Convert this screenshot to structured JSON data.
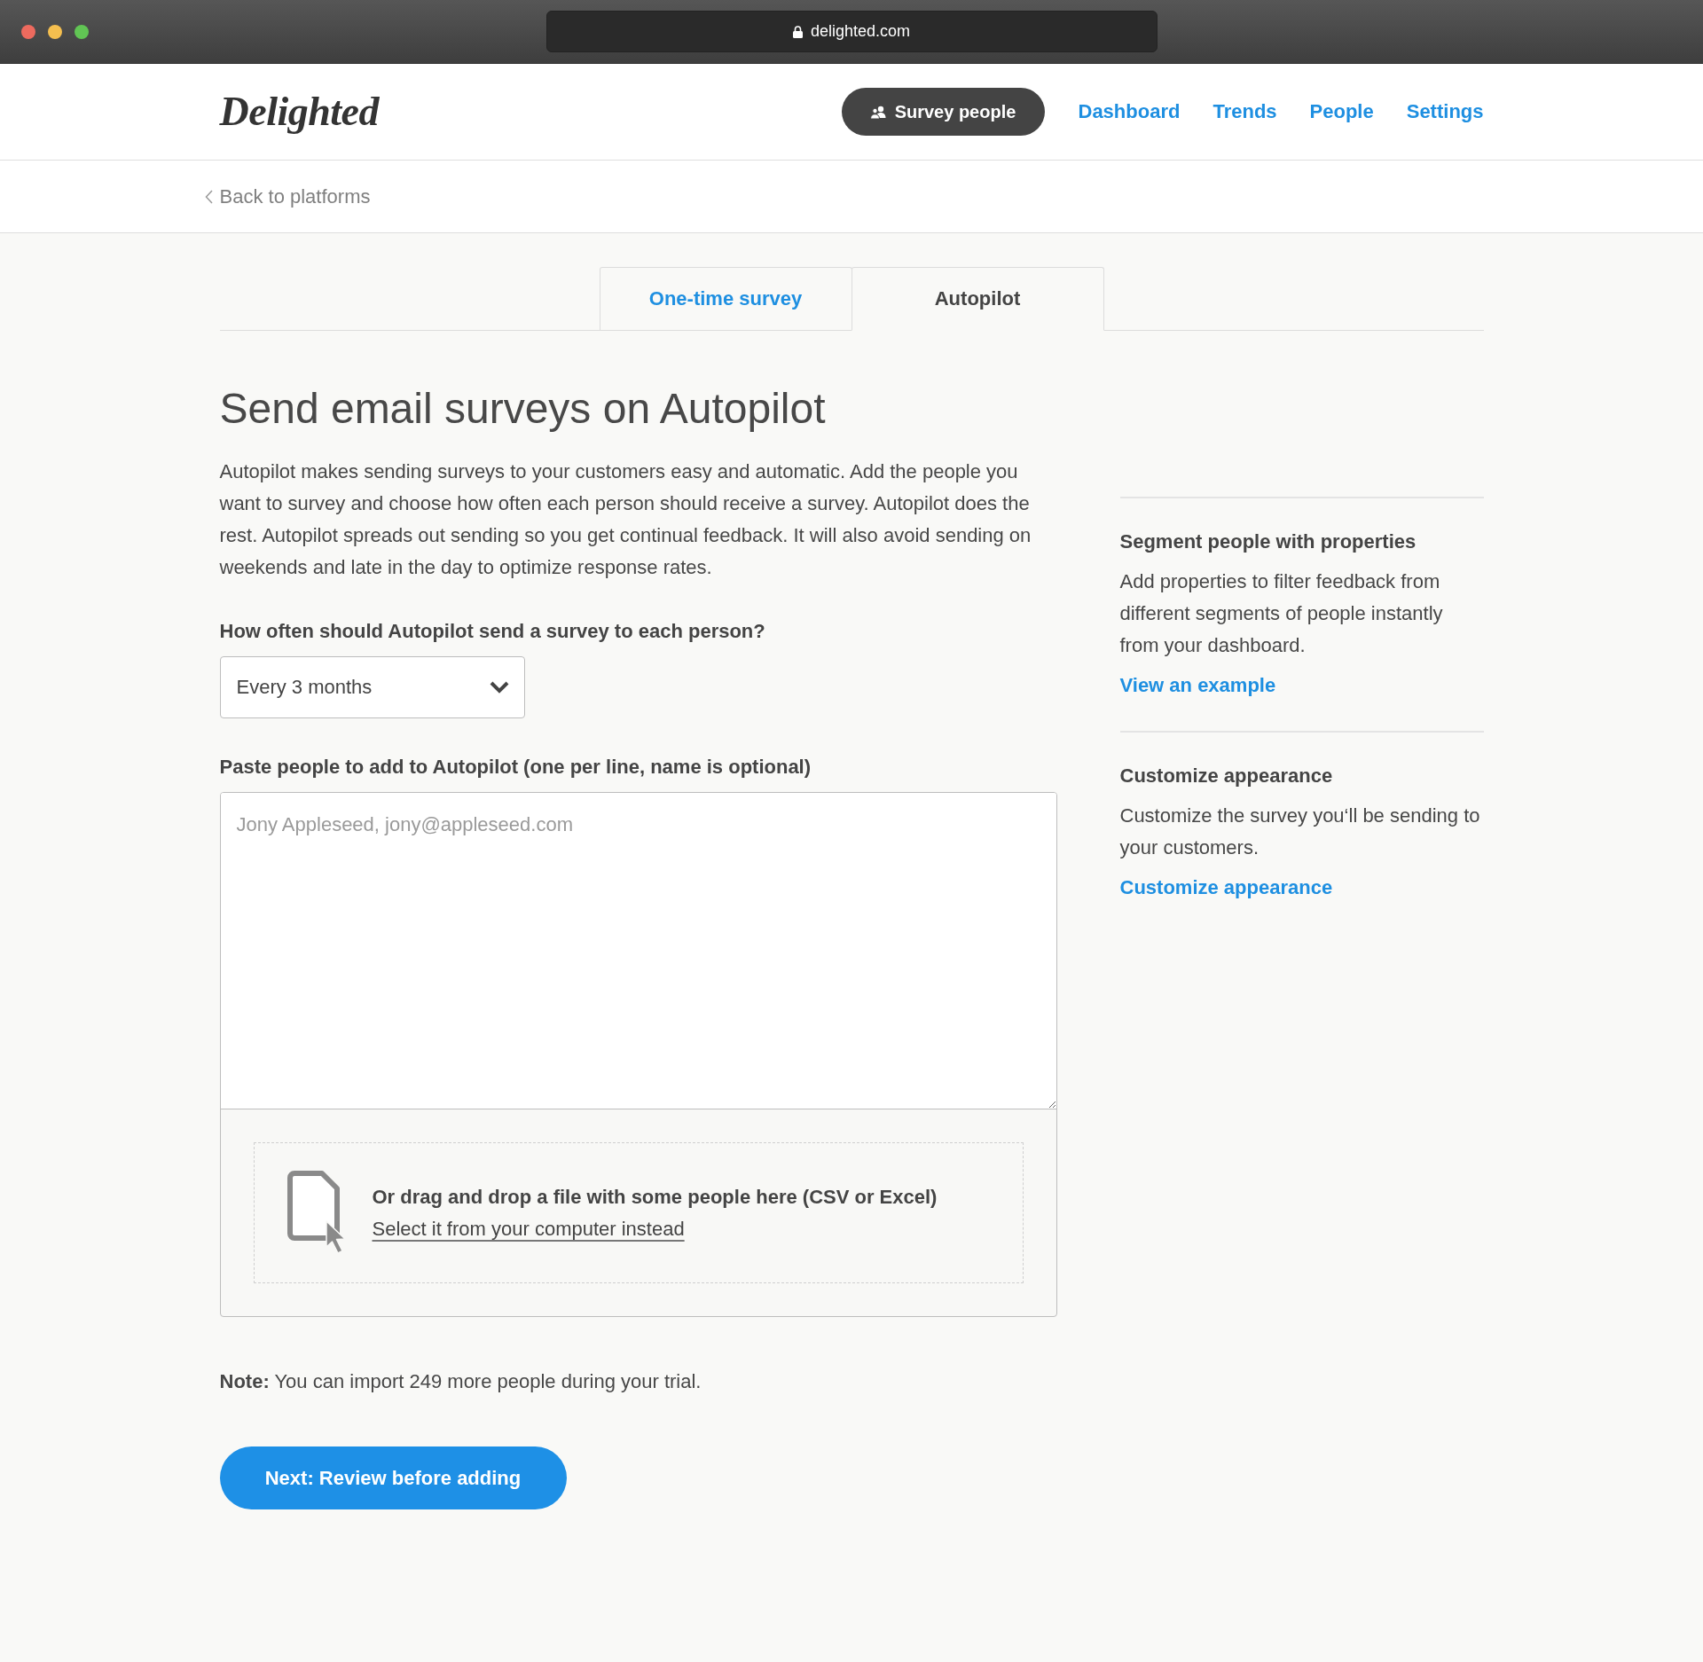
{
  "browser": {
    "url": "delighted.com"
  },
  "header": {
    "logo": "Delighted",
    "action_button": "Survey people",
    "nav": [
      {
        "label": "Dashboard"
      },
      {
        "label": "Trends"
      },
      {
        "label": "People"
      },
      {
        "label": "Settings"
      }
    ]
  },
  "back_link": "Back to platforms",
  "tabs": [
    {
      "label": "One-time survey",
      "selected": false
    },
    {
      "label": "Autopilot",
      "selected": true
    }
  ],
  "main": {
    "title": "Send email surveys on Autopilot",
    "intro": "Autopilot makes sending surveys to your customers easy and automatic. Add the people you want to survey and choose how often each person should receive a survey. Autopilot does the rest. Autopilot spreads out sending so you get continual feedback. It will also avoid sending on weekends and late in the day to optimize response rates.",
    "frequency": {
      "label": "How often should Autopilot send a survey to each person?",
      "value": "Every 3 months"
    },
    "people": {
      "label": "Paste people to add to Autopilot (one per line, name is optional)",
      "placeholder": "Jony Appleseed, jony@appleseed.com"
    },
    "dropzone": {
      "text": "Or drag and drop a file with some people here (CSV or Excel)",
      "link": "Select it from your computer instead"
    },
    "note": "**Note:** You can import 249 more people during your trial.",
    "submit_button": "Next: Review before adding"
  },
  "sidebar": [
    {
      "title": "Segment people with properties",
      "text": "Add properties to filter feedback from different segments of people instantly from your dashboard.",
      "link": "View an example"
    },
    {
      "title": "Customize appearance",
      "text": "Customize the survey you‘ll be sending to your customers.",
      "link": "Customize appearance"
    }
  ]
}
